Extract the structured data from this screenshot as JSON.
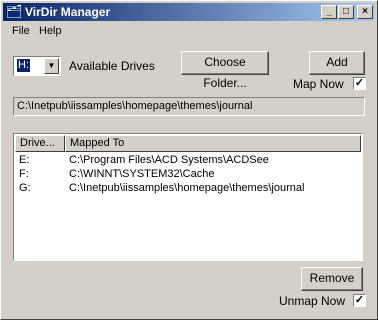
{
  "window": {
    "title": "VirDir Manager",
    "controls": {
      "minimize": "_",
      "maximize": "□",
      "close": "×"
    }
  },
  "menu": {
    "items": [
      "File",
      "Help"
    ]
  },
  "drive_select": {
    "value": "H:",
    "label": "Available Drives"
  },
  "buttons": {
    "choose_folder": "Choose Folder...",
    "add": "Add",
    "remove": "Remove"
  },
  "map_now": {
    "label": "Map Now",
    "checked": "✓"
  },
  "path": {
    "value": "C:\\Inetpub\\iissamples\\homepage\\themes\\journal"
  },
  "list": {
    "columns": [
      "Drive...",
      "Mapped To"
    ],
    "rows": [
      {
        "drive": "E:",
        "mapped": "C:\\Program Files\\ACD Systems\\ACDSee"
      },
      {
        "drive": "F:",
        "mapped": "C:\\WINNT\\SYSTEM32\\Cache"
      },
      {
        "drive": "G:",
        "mapped": "C:\\Inetpub\\iissamples\\homepage\\themes\\journal"
      }
    ]
  },
  "unmap_now": {
    "label": "Unmap Now",
    "checked": "✓"
  },
  "colors": {
    "titlebar_start": "#0a246a",
    "titlebar_end": "#a6caf0",
    "face": "#d4d0c8"
  },
  "icons": {
    "app": "folder-icon"
  }
}
